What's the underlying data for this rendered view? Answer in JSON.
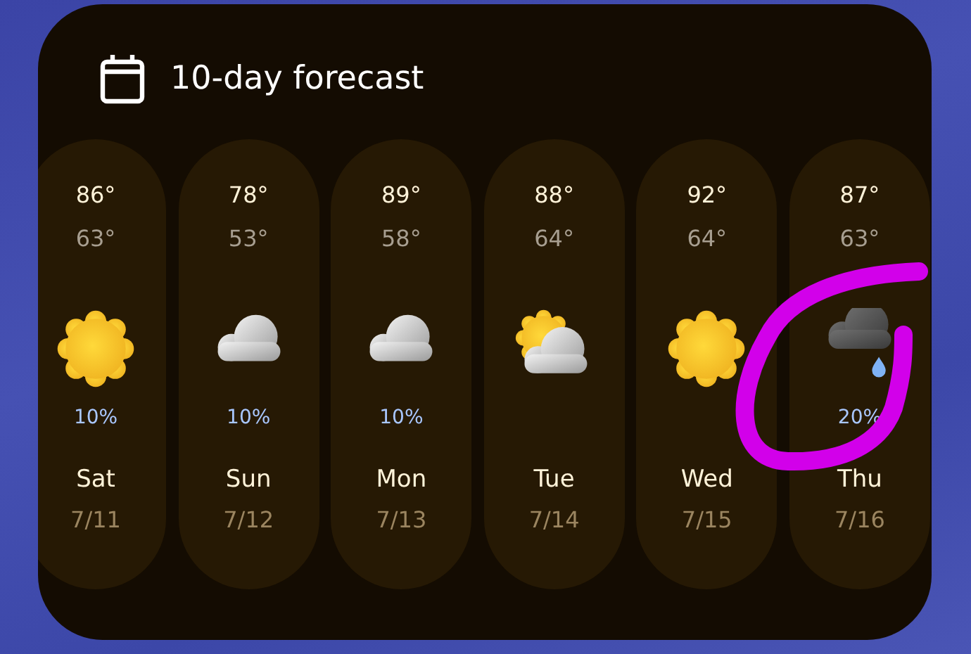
{
  "widget": {
    "title": "10-day forecast"
  },
  "days": [
    {
      "high": "86°",
      "low": "63°",
      "kind": "sunny",
      "precipitation": "10%",
      "day": "Sat",
      "date": "7/11"
    },
    {
      "high": "78°",
      "low": "53°",
      "kind": "cloudy",
      "precipitation": "10%",
      "day": "Sun",
      "date": "7/12"
    },
    {
      "high": "89°",
      "low": "58°",
      "kind": "cloudy",
      "precipitation": "10%",
      "day": "Mon",
      "date": "7/13"
    },
    {
      "high": "88°",
      "low": "64°",
      "kind": "partly-cloudy",
      "day": "Tue",
      "date": "7/14"
    },
    {
      "high": "92°",
      "low": "64°",
      "kind": "sunny",
      "day": "Wed",
      "date": "7/15"
    },
    {
      "high": "87°",
      "low": "63°",
      "kind": "rain",
      "precipitation": "20%",
      "day": "Thu",
      "date": "7/16"
    }
  ]
}
